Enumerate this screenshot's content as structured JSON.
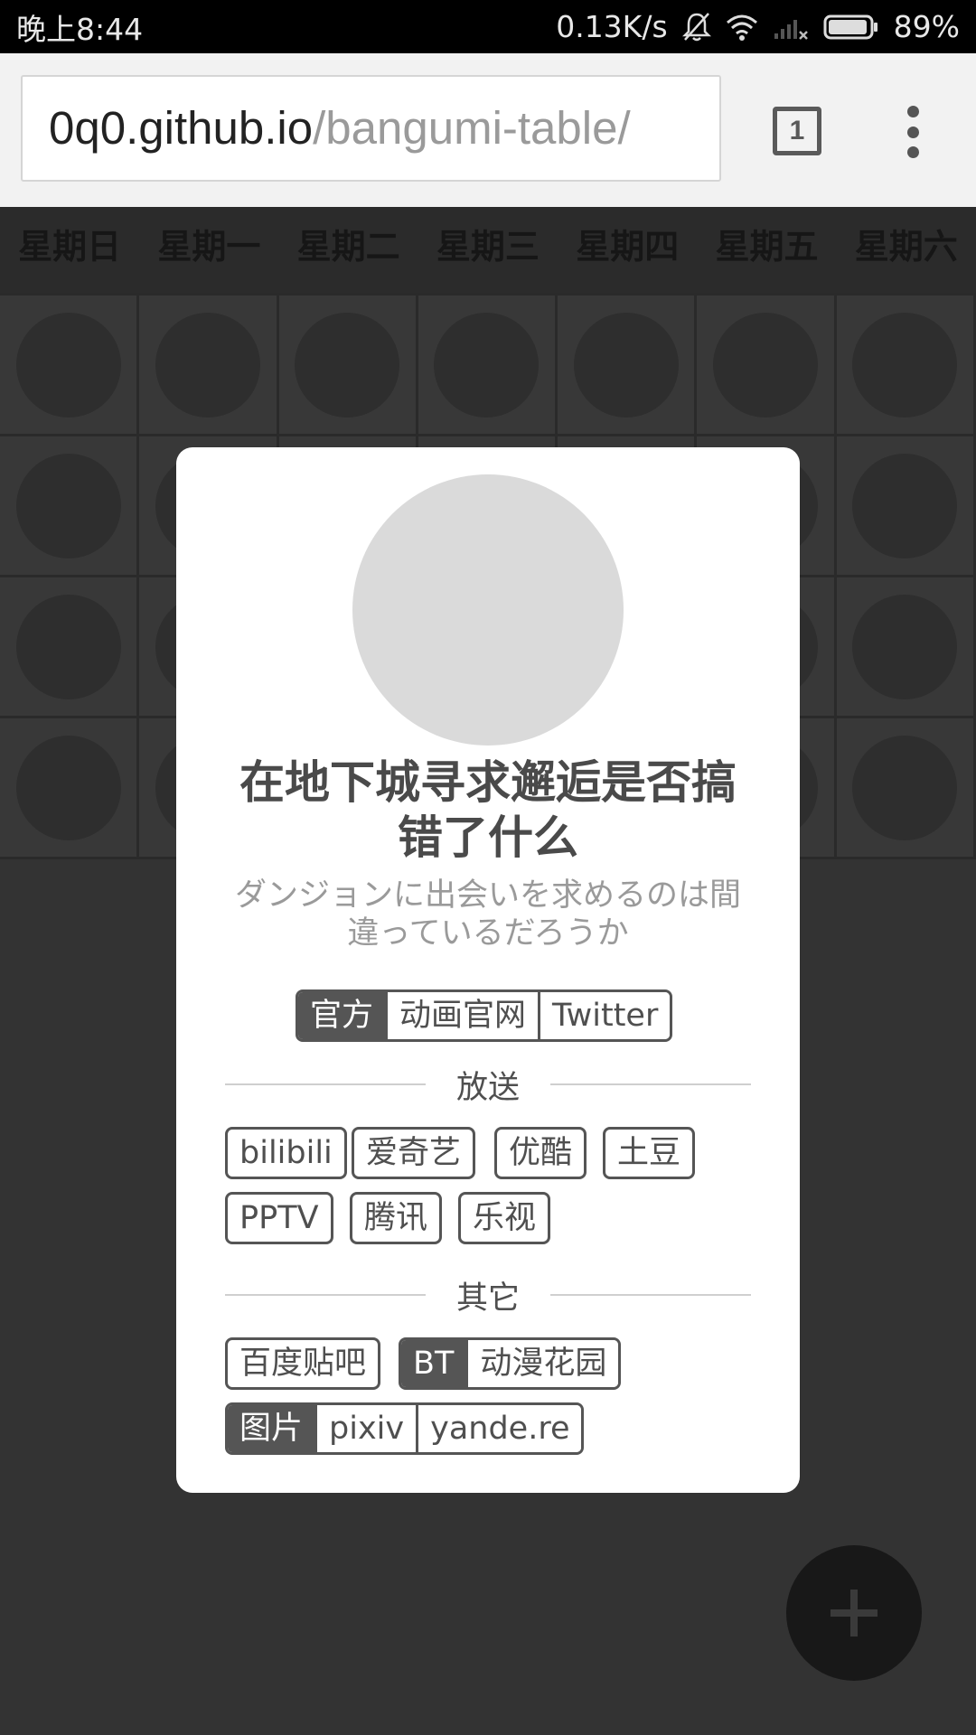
{
  "status_bar": {
    "time": "晚上8:44",
    "net_speed": "0.13K/s",
    "battery": "89%"
  },
  "browser": {
    "url_host": "0q0.github.io",
    "url_path": "/bangumi-table/",
    "tab_count": "1"
  },
  "weekdays": [
    "星期日",
    "星期一",
    "星期二",
    "星期三",
    "星期四",
    "星期五",
    "星期六"
  ],
  "modal": {
    "title": "在地下城寻求邂逅是否搞错了什么",
    "subtitle": "ダンジョンに出会いを求めるのは間違っているだろうか",
    "official": {
      "label": "官方",
      "links": [
        "动画官网",
        "Twitter"
      ]
    },
    "broadcast_heading": "放送",
    "broadcast_links": [
      "bilibili",
      "爱奇艺",
      "优酷",
      "土豆",
      "PPTV",
      "腾讯",
      "乐视"
    ],
    "other_heading": "其它",
    "other": {
      "tieba": "百度贴吧",
      "bt_label": "BT",
      "bt_link": "动漫花园",
      "image_label": "图片",
      "image_links": [
        "pixiv",
        "yande.re"
      ]
    }
  }
}
